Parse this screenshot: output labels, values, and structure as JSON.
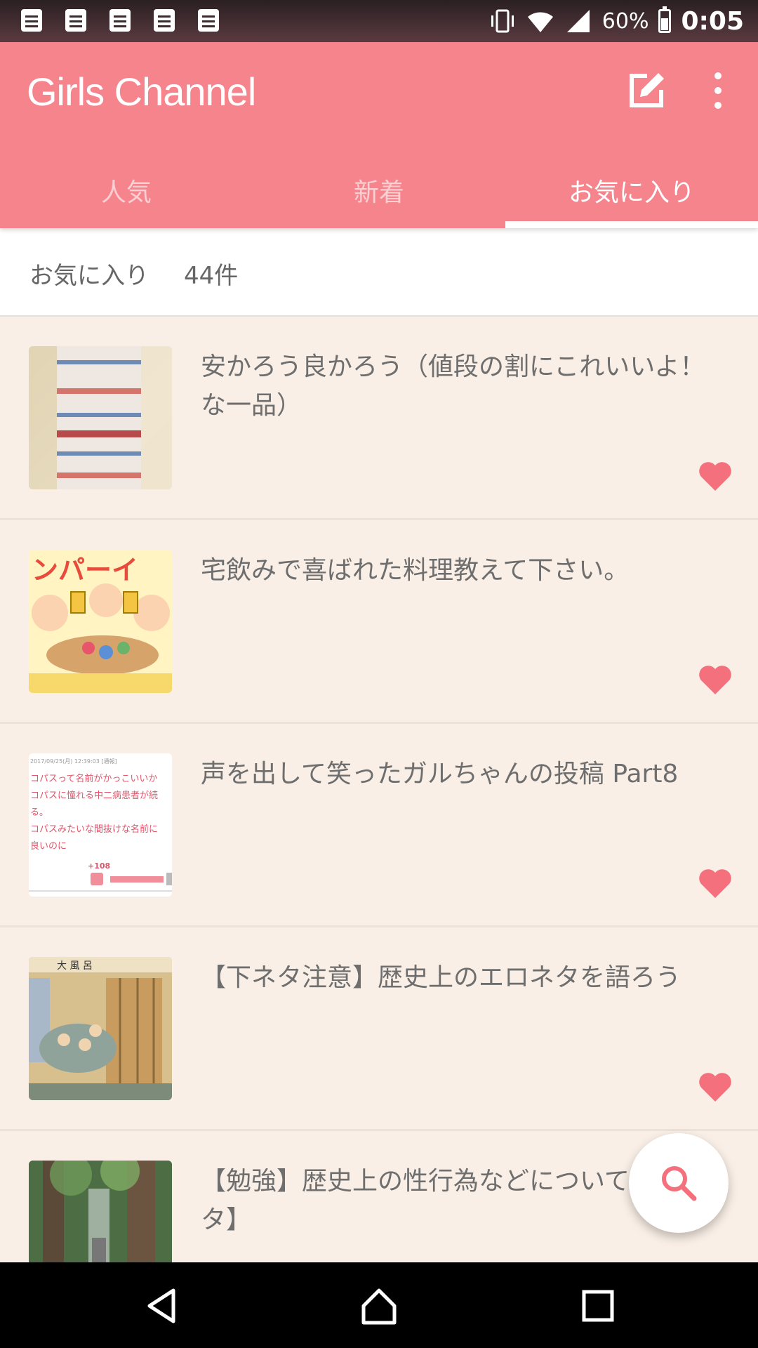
{
  "status_bar": {
    "notification_icons": [
      "notepad-icon",
      "notepad-icon",
      "notepad-icon",
      "notepad-icon",
      "notepad-icon"
    ],
    "battery_percent": "60%",
    "clock": "0:05"
  },
  "app_bar": {
    "title": "Girls Channel",
    "compose_icon": "compose-icon",
    "more_icon": "more-vert-icon"
  },
  "tabs": [
    {
      "label": "人気",
      "active": false
    },
    {
      "label": "新着",
      "active": false
    },
    {
      "label": "お気に入り",
      "active": true
    }
  ],
  "favorites": {
    "label": "お気に入り",
    "count": "44件"
  },
  "items": [
    {
      "title": "安かろう良かろう（値段の割にこれいいよ！な一品）",
      "thumb": "washi-tape-photo",
      "favorited": true
    },
    {
      "title": "宅飲みで喜ばれた料理教えて下さい。",
      "thumb": "kanpai-illustration",
      "favorited": true
    },
    {
      "title": "声を出して笑ったガルちゃんの投稿 Part8",
      "thumb": "comment-screenshot",
      "favorited": true
    },
    {
      "title": "【下ネタ注意】歴史上のエロネタを語ろう",
      "thumb": "ukiyoe-bathhouse",
      "favorited": true
    },
    {
      "title": "【勉強】歴史上の性行為などについて【下ネタ】",
      "thumb": "cedar-forest-photo",
      "favorited": true
    }
  ],
  "thumb_text": {
    "kanpai": "ンパーイ",
    "screenshot_date": "2017/09/25(月) 12:39:03 [通報]",
    "screenshot_line1": "コパスって名前がかっこいいか",
    "screenshot_line2": "コパスに憧れる中二病患者が続",
    "screenshot_line3": "る。",
    "screenshot_line4": "コパスみたいな間抜けな名前に",
    "screenshot_line5": "良いのに",
    "screenshot_votes": "+108",
    "ukiyoe_label": "大 風 呂"
  },
  "fab": {
    "icon": "search-icon"
  },
  "nav_bar": {
    "back": "back-icon",
    "home": "home-icon",
    "recents": "recents-icon"
  },
  "colors": {
    "accent": "#f5848d",
    "background": "#f9efe6",
    "heart": "#f3707c"
  }
}
